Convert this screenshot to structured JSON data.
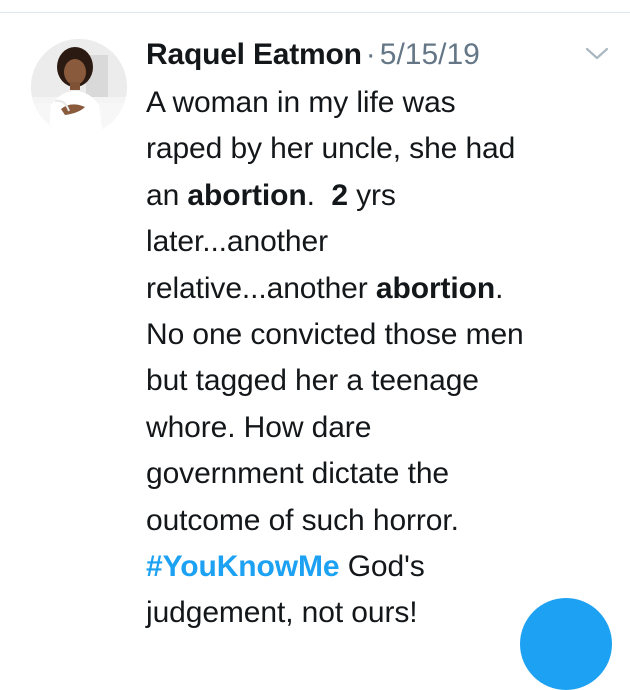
{
  "tweet": {
    "author": "Raquel Eatmon",
    "separator": "·",
    "date": "5/15/19",
    "text_lines": {
      "l1": "A woman in my life was",
      "l2": "raped by her uncle, she had",
      "l3a": "an ",
      "l3b": "abortion",
      "l3c": ".  ",
      "l3d": "2",
      "l3e": " yrs",
      "l4": "later...another",
      "l5a": "relative...another ",
      "l5b": "abortion",
      "l5c": ".",
      "l6": "No one convicted those men",
      "l7": "but tagged her a teenage",
      "l8": "whore. How dare",
      "l9": "government dictate the",
      "l10": "outcome of such horror.",
      "l11_hashtag": "#YouKnowMe",
      "l11_rest": " God's",
      "l12": "judgement, not ours!"
    }
  },
  "icons": {
    "menu": "chevron-down-icon",
    "avatar": "profile-photo"
  },
  "colors": {
    "text": "#14171a",
    "muted": "#657786",
    "accent": "#1da1f2",
    "divider": "#e1e8ed"
  }
}
